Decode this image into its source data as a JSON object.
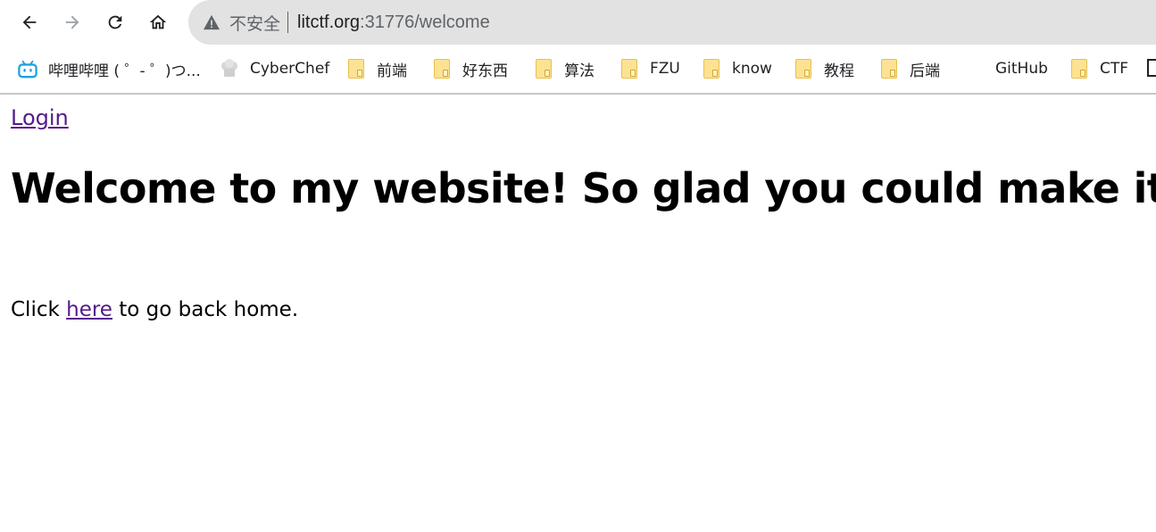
{
  "browser": {
    "insecure_label": "不安全",
    "url_host": "litctf.org",
    "url_rest": ":31776/welcome"
  },
  "bookmarks": [
    {
      "label": "哔哩哔哩 ( ゜- ゜)つ...",
      "icon": "bilibili-icon"
    },
    {
      "label": "CyberChef",
      "icon": "chef-hat-icon"
    },
    {
      "label": "前端",
      "icon": "folder-icon"
    },
    {
      "label": "好东西",
      "icon": "folder-icon"
    },
    {
      "label": "算法",
      "icon": "folder-icon"
    },
    {
      "label": "FZU",
      "icon": "folder-icon"
    },
    {
      "label": "know",
      "icon": "folder-icon"
    },
    {
      "label": "教程",
      "icon": "folder-icon"
    },
    {
      "label": "后端",
      "icon": "folder-icon"
    },
    {
      "label": "GitHub",
      "icon": ""
    },
    {
      "label": "CTF",
      "icon": "folder-icon"
    }
  ],
  "page": {
    "login_link": "Login",
    "heading": "Welcome to my website! So glad you could make it.",
    "click_prefix": "Click ",
    "here_link": "here",
    "click_suffix": " to go back home."
  },
  "colors": {
    "visited_link": "#551a8b",
    "omnibox_bg": "#e2e2e2",
    "folder": "#fde293"
  }
}
